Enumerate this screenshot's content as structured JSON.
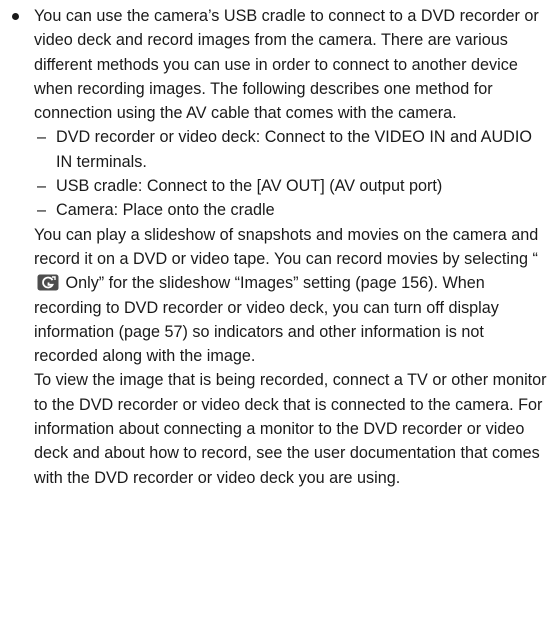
{
  "intro": "You can use the camera’s USB cradle to connect to a DVD recorder or video deck and record images from the camera. There are various different methods you can use in order to connect to another device when recording images. The following describes one method for connection using the AV cable that comes with the camera.",
  "connections": [
    {
      "dash": "–",
      "text": "DVD recorder or video deck: Connect to the VIDEO IN and AUDIO IN terminals."
    },
    {
      "dash": "–",
      "text": "USB cradle: Connect to the [AV OUT] (AV output port)"
    },
    {
      "dash": "–",
      "text": "Camera: Place onto the cradle"
    }
  ],
  "slideshow": {
    "before_icon": "You can play a slideshow of snapshots and movies on the camera and record it on a DVD or video tape. You can record movies by selecting “",
    "icon": "movie-mode-icon",
    "after_icon": " Only” for the slideshow “Images” setting (page 156). When recording to DVD recorder or video deck, you can turn off display information (page 57) so indicators and other information is not recorded along with the image."
  },
  "viewing": "To view the image that is being recorded, connect a TV or other monitor to the DVD recorder or video deck that is connected to the camera. For information about connecting a monitor to the DVD recorder or video deck and about how to record, see the user documentation that comes with the DVD recorder or video deck you are using.",
  "colors": {
    "text": "#1a1a1a",
    "icon_fill": "#4d4d4d",
    "icon_stroke": "#ffffff"
  }
}
